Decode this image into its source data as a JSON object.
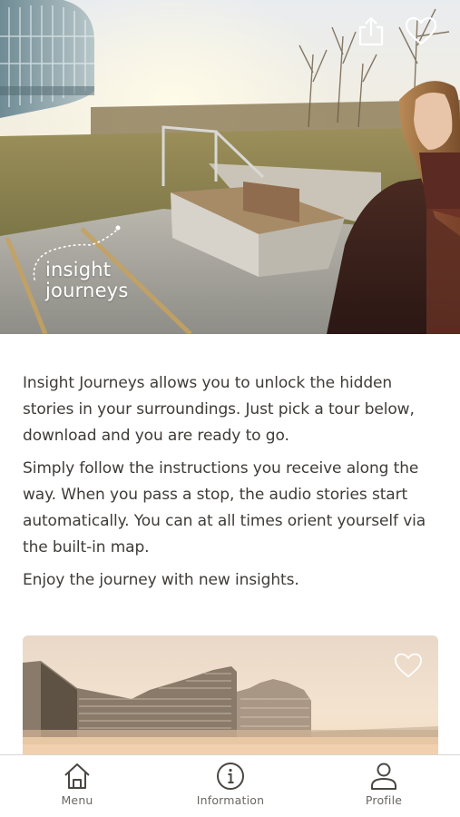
{
  "hero": {
    "logo": {
      "line1": "insight",
      "line2": "journeys"
    },
    "share_icon": "share-icon",
    "favorite_icon": "heart-outline-icon"
  },
  "intro": {
    "paragraphs": [
      "Insight Journeys allows you to unlock the hidden stories in your surroundings. Just pick a tour below, download and you are ready to go.",
      "Simply follow the instructions you receive along the way. When you pass a stop, the audio stories start automatically. You can at all times orient yourself via the built-in map.",
      "Enjoy the journey with new insights."
    ]
  },
  "tour_card": {
    "favorite_icon": "heart-outline-icon"
  },
  "bottom_nav": {
    "items": [
      {
        "label": "Menu",
        "icon": "home-icon"
      },
      {
        "label": "Information",
        "icon": "info-icon"
      },
      {
        "label": "Profile",
        "icon": "profile-icon"
      }
    ]
  },
  "colors": {
    "text": "#3f3b37",
    "nav_text": "#6a6662",
    "divider": "#d8d6d3"
  }
}
